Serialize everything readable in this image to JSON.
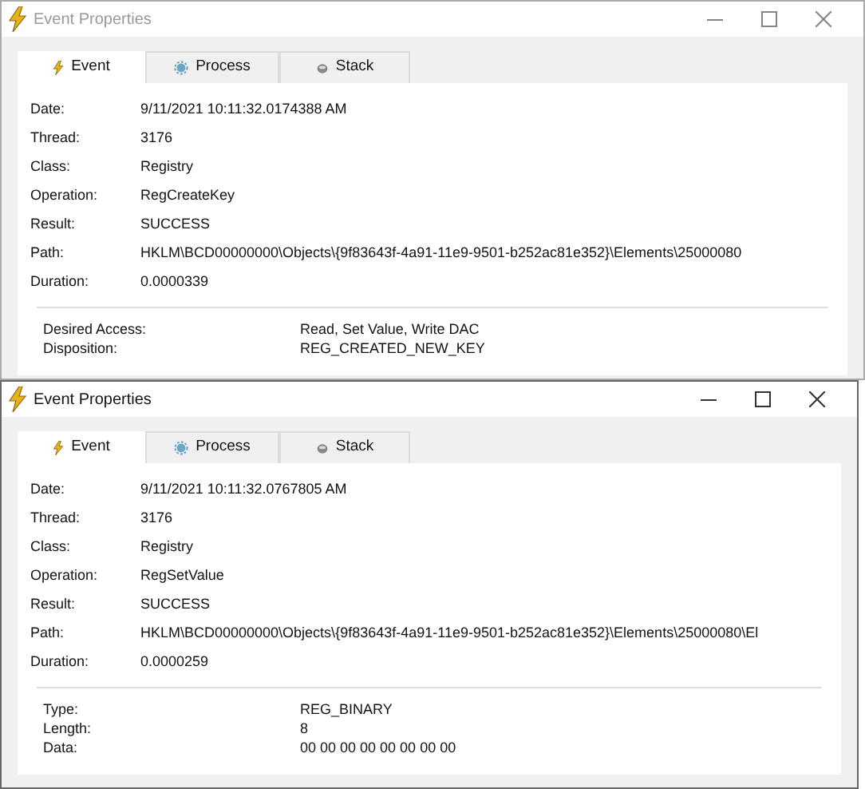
{
  "windows": [
    {
      "title": "Event Properties",
      "active": false,
      "tabs": [
        {
          "label": "Event",
          "selected": true
        },
        {
          "label": "Process",
          "selected": false
        },
        {
          "label": "Stack",
          "selected": false
        }
      ],
      "properties": [
        {
          "label": "Date:",
          "value": "9/11/2021 10:11:32.0174388 AM"
        },
        {
          "label": "Thread:",
          "value": "3176"
        },
        {
          "label": "Class:",
          "value": "Registry"
        },
        {
          "label": "Operation:",
          "value": "RegCreateKey"
        },
        {
          "label": "Result:",
          "value": "SUCCESS"
        },
        {
          "label": "Path:",
          "value": "HKLM\\BCD00000000\\Objects\\{9f83643f-4a91-11e9-9501-b252ac81e352}\\Elements\\25000080"
        },
        {
          "label": "Duration:",
          "value": "0.0000339"
        }
      ],
      "details": [
        {
          "label": "Desired Access:",
          "value": "Read, Set Value, Write DAC"
        },
        {
          "label": "Disposition:",
          "value": "REG_CREATED_NEW_KEY"
        }
      ]
    },
    {
      "title": "Event Properties",
      "active": true,
      "tabs": [
        {
          "label": "Event",
          "selected": true
        },
        {
          "label": "Process",
          "selected": false
        },
        {
          "label": "Stack",
          "selected": false
        }
      ],
      "properties": [
        {
          "label": "Date:",
          "value": "9/11/2021 10:11:32.0767805 AM"
        },
        {
          "label": "Thread:",
          "value": "3176"
        },
        {
          "label": "Class:",
          "value": "Registry"
        },
        {
          "label": "Operation:",
          "value": "RegSetValue"
        },
        {
          "label": "Result:",
          "value": "SUCCESS"
        },
        {
          "label": "Path:",
          "value": "HKLM\\BCD00000000\\Objects\\{9f83643f-4a91-11e9-9501-b252ac81e352}\\Elements\\25000080\\El"
        },
        {
          "label": "Duration:",
          "value": "0.0000259"
        }
      ],
      "details": [
        {
          "label": "Type:",
          "value": "REG_BINARY"
        },
        {
          "label": "Length:",
          "value": "8"
        },
        {
          "label": "Data:",
          "value": "00 00 00 00 00 00 00 00"
        }
      ]
    }
  ]
}
